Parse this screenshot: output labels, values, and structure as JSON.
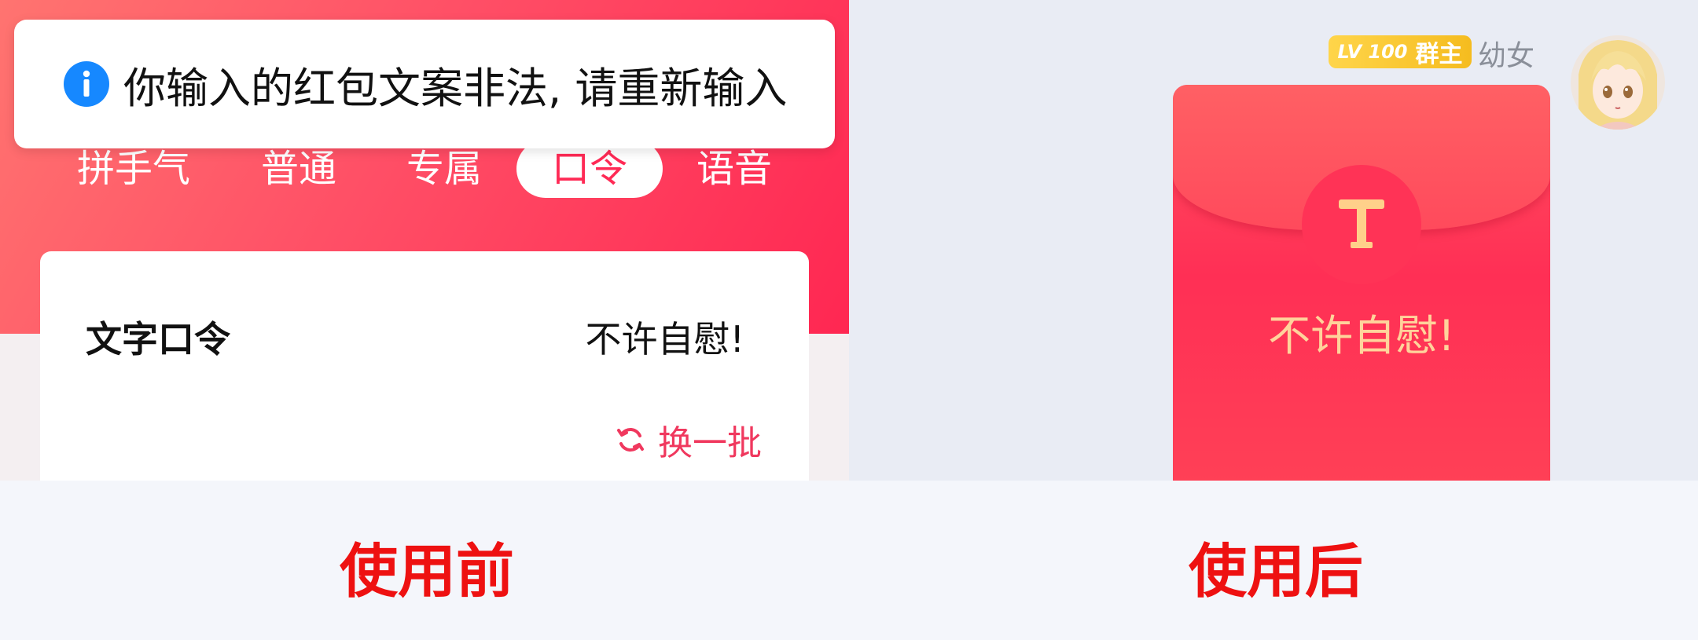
{
  "before_panel": {
    "toast": {
      "icon": "info-icon",
      "message": "你输入的红包文案非法, 请重新输入"
    },
    "tabs": [
      {
        "label": "拼手气",
        "active": false
      },
      {
        "label": "普通",
        "active": false
      },
      {
        "label": "专属",
        "active": false
      },
      {
        "label": "口令",
        "active": true
      },
      {
        "label": "语音",
        "active": false
      }
    ],
    "card": {
      "label": "文字口令",
      "value": "不许自慰!",
      "refresh_label": "换一批",
      "refresh_icon": "refresh-icon"
    }
  },
  "after_panel": {
    "badge": {
      "level": "LV 100",
      "role": "群主"
    },
    "nickname": "幼女",
    "avatar_icon": "anime-avatar",
    "envelope": {
      "seal_icon": "t-seal-icon",
      "text": "不许自慰!"
    }
  },
  "captions": {
    "before": "使用前",
    "after": "使用后"
  },
  "colors": {
    "brand_red": "#ff2752",
    "caption_red": "#ee1111",
    "toast_icon_blue": "#1688ff",
    "badge_gold": "#ffd54a",
    "envelope_text_gold": "#ffd39b"
  }
}
